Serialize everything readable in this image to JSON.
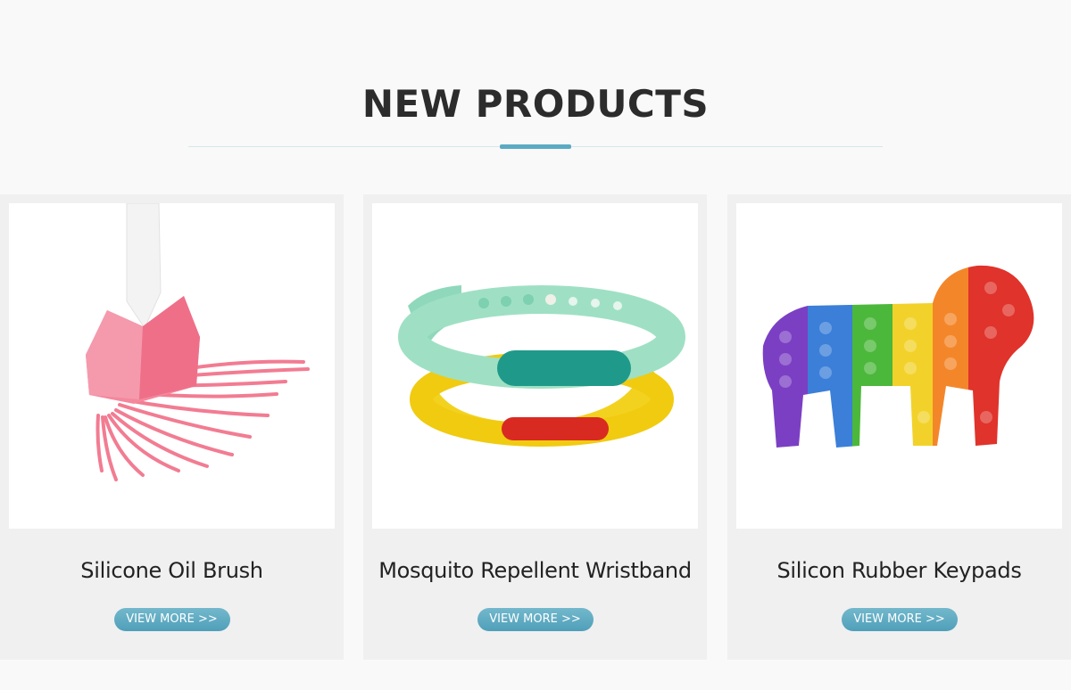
{
  "section": {
    "title": "NEW PRODUCTS",
    "accent_color": "#5aaac2"
  },
  "products": [
    {
      "name": "Silicone Oil Brush",
      "button_label": "VIEW MORE >>",
      "image": "silicone-oil-brush-image"
    },
    {
      "name": "Mosquito Repellent Wristband",
      "button_label": "VIEW MORE >>",
      "image": "mosquito-wristband-image"
    },
    {
      "name": "Silicon Rubber Keypads",
      "button_label": "VIEW MORE >>",
      "image": "rainbow-lion-pop-keypad-image"
    }
  ]
}
